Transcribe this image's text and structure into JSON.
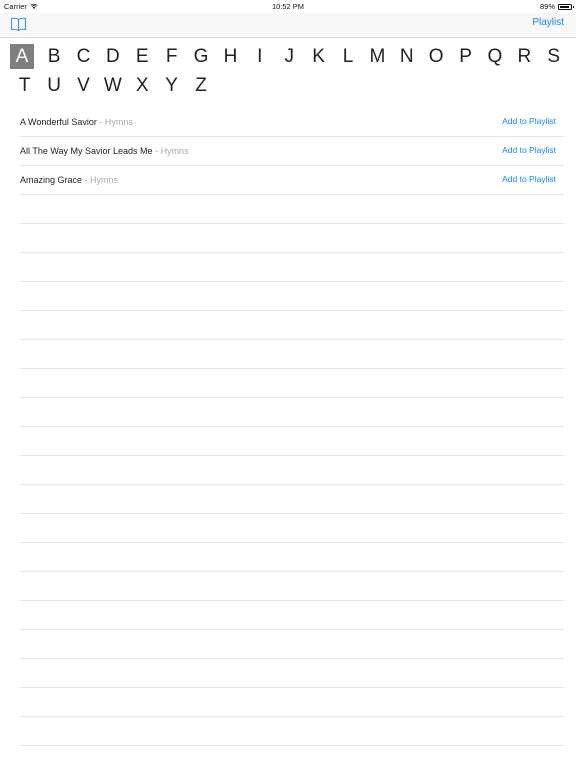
{
  "status_bar": {
    "carrier": "Carrier",
    "time": "10:52 PM",
    "battery": "89%"
  },
  "nav": {
    "playlist_label": "Playlist",
    "left_icon": "book-icon"
  },
  "alphabet": {
    "selected": "A",
    "row1": [
      "A",
      "B",
      "C",
      "D",
      "E",
      "F",
      "G",
      "H",
      "I",
      "J",
      "K",
      "L",
      "M",
      "N",
      "O",
      "P",
      "Q",
      "R",
      "S"
    ],
    "row2": [
      "T",
      "U",
      "V",
      "W",
      "X",
      "Y",
      "Z"
    ]
  },
  "songs": [
    {
      "title": "A Wonderful Savior",
      "separator": " - ",
      "category": "Hymns",
      "action": "Add to Playlist"
    },
    {
      "title": "All The Way My Savior Leads Me",
      "separator": " - ",
      "category": "Hymns",
      "action": "Add to Playlist"
    },
    {
      "title": "Amazing Grace",
      "separator": " - ",
      "category": "Hymns",
      "action": "Add to Playlist"
    }
  ],
  "empty_row_count": 19,
  "colors": {
    "accent": "#1a82fb",
    "selected_letter_bg": "#7f7f7f",
    "secondary_text": "#a9a9a9"
  }
}
